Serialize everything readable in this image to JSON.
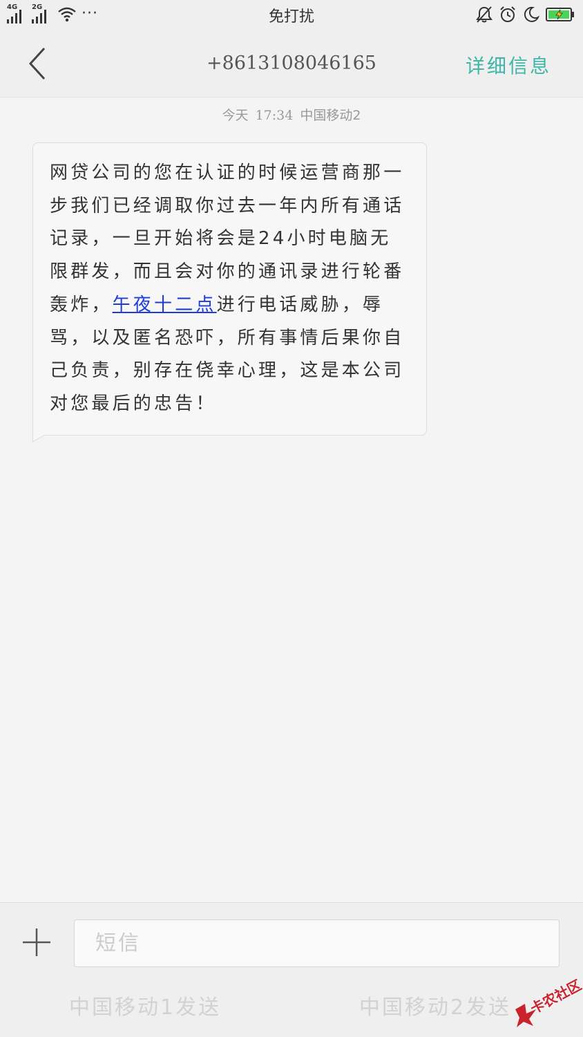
{
  "status_bar": {
    "signal_1_label": "4G",
    "signal_2_label": "2G",
    "more_label": "···",
    "title": "免打扰",
    "icons": [
      "notifications-off-icon",
      "alarm-clock-icon",
      "moon-icon",
      "battery-charging-icon"
    ]
  },
  "header": {
    "contact_number": "+8613108046165",
    "details_label": "详细信息"
  },
  "message": {
    "date": "今天",
    "time": "17:34",
    "sim": "中国移动2",
    "text_before": "网贷公司的您在认证的时候运营商那一步我们已经调取你过去一年内所有通话记录，一旦开始将会是24小时电脑无限群发，而且会对你的通讯录进行轮番轰炸，",
    "link_text": "午夜十二点",
    "text_after": "进行电话威胁，辱骂，以及匿名恐吓，所有事情后果你自己负责，别存在侥幸心理，这是本公司对您最后的忠告！"
  },
  "composer": {
    "placeholder": "短信",
    "send_sim1_label": "中国移动1发送",
    "send_sim2_label": "中国移动2发送"
  },
  "watermark": {
    "text": "卡农社区"
  },
  "colors": {
    "accent": "#3fb6a8",
    "link": "#1e3bd6",
    "background": "#f4f4f4",
    "watermark": "#c9232b"
  }
}
